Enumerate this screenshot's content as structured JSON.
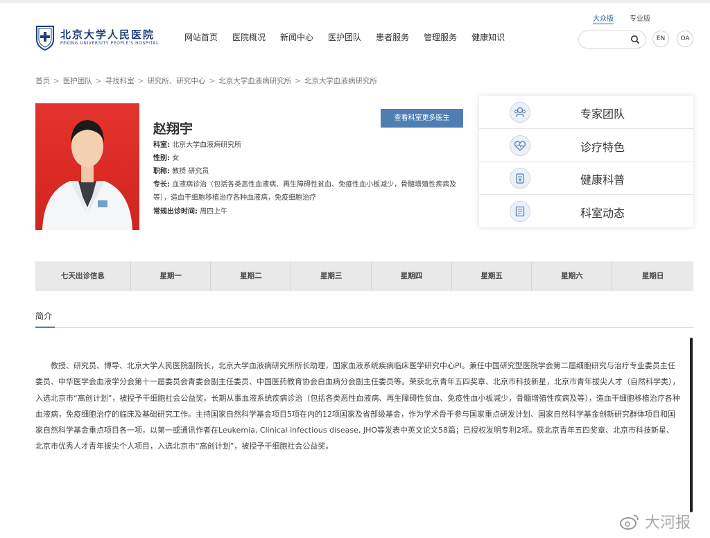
{
  "header": {
    "version_links": [
      "大众版",
      "专业版"
    ],
    "logo_cn": "北京大学人民医院",
    "logo_en": "PEKING UNIVERSITY PEOPLE'S HOSPITAL",
    "nav": [
      "网站首页",
      "医院概况",
      "新闻中心",
      "医护团队",
      "患者服务",
      "管理服务",
      "健康知识"
    ],
    "search_placeholder": "",
    "btn_en": "EN",
    "btn_oa": "OA"
  },
  "breadcrumb": [
    "首页",
    "医护团队",
    "寻找科室",
    "研究所、研究中心",
    "北京大学血液病研究所",
    "北京大学血液病研究所"
  ],
  "doctor": {
    "name": "赵翔宇",
    "dept_label": "科室:",
    "dept": "北京大学血液病研究所",
    "gender_label": "性别:",
    "gender": "女",
    "title_label": "职称:",
    "title": "教授 研究员",
    "specialty_label": "专长:",
    "specialty": "血液病诊治（包括各类恶性血液病、再生障碍性贫血、免疫性血小板减少，骨髓增殖性疾病及等），造血干细胞移植治疗各种血液病，免疫细胞治疗",
    "clinic_label": "常规出诊时间:",
    "clinic": "周四上午",
    "more_button": "查看科室更多医生"
  },
  "panel": [
    {
      "label": "专家团队",
      "icon": "team-icon"
    },
    {
      "label": "诊疗特色",
      "icon": "heart-icon"
    },
    {
      "label": "健康科普",
      "icon": "medicine-icon"
    },
    {
      "label": "科室动态",
      "icon": "news-icon"
    }
  ],
  "schedule": [
    "七天出诊信息",
    "星期一",
    "星期二",
    "星期三",
    "星期四",
    "星期五",
    "星期六",
    "星期日"
  ],
  "intro": {
    "tab": "简介",
    "text": "教授、研究员、博导、北京大学人民医院副院长，北京大学血液病研究所所长助理，国家血液系统疾病临床医学研究中心PI。兼任中国研究型医院学会第二届细胞研究与治疗专业委员主任委员、中华医学会血液学分会第十一届委员会青委会副主任委员、中国医药教育协会白血病分会副主任委员等。荣获北京青年五四奖章、北京市科技新星，北京市青年拔尖人才（自然科学类），入选北京市“高创计划”，被授予干细胞社会公益奖。长期从事血液系统疾病诊治（包括各类恶性血液病、再生障碍性贫血、免疫性血小板减少，骨髓增殖性疾病及等），造血干细胞移植治疗各种血液病，免疫细胞治疗的临床及基础研究工作。主持国家自然科学基金项目5项在内的12项国家及省部级基金，作为学术骨干参与国家重点研发计划、国家自然科学基金创新研究群体项目和国家自然科学基金重点项目各一项，以第一或通讯作者在Leukemia, Clinical infectious disease, JHO等发表中英文论文58篇；已授权发明专利2项。获北京青年五四奖章、北京市科技新星、北京市优秀人才青年拔尖个人项目，入选北京市“高创计划”，被授予干细胞社会公益奖。"
  },
  "watermark": "大河报",
  "colors": {
    "accent": "#4d7fb3",
    "logo": "#1e3f7a",
    "photo_bg": "#d92a24"
  }
}
